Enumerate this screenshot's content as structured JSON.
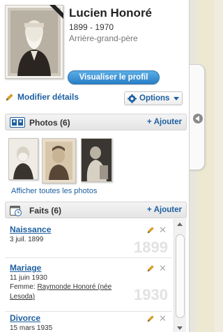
{
  "person": {
    "name": "Lucien Honoré",
    "years": "1899 - 1970",
    "relation": "Arrière-grand-père"
  },
  "buttons": {
    "view_profile": "Visualiser le profil",
    "edit_details": "Modifier détails",
    "options": "Options"
  },
  "photos": {
    "title": "Photos (6)",
    "add": "Ajouter",
    "see_all": "Afficher toutes les photos"
  },
  "facts": {
    "title": "Faits (6)",
    "add": "Ajouter",
    "items": [
      {
        "title": "Naissance",
        "date": "3 juil. 1899",
        "year": "1899"
      },
      {
        "title": "Mariage",
        "date": "11 juin 1930",
        "detail_prefix": "Femme: ",
        "spouse": "Raymonde Honoré (née Lesoda)",
        "year": "1930"
      },
      {
        "title": "Divorce",
        "date": "15 mars 1935",
        "year": ""
      }
    ]
  },
  "icons": {
    "portrait": "portrait-photo",
    "ribbon": "deceased-ribbon-icon",
    "edit": "pencil-icon",
    "options": "gear-icon",
    "photos": "photos-icon",
    "facts": "calendar-clock-icon",
    "collapse": "chevron-left-icon"
  },
  "colors": {
    "link": "#1e5fa0",
    "button": "#2a7fc6",
    "pencil": "#e8a317"
  }
}
